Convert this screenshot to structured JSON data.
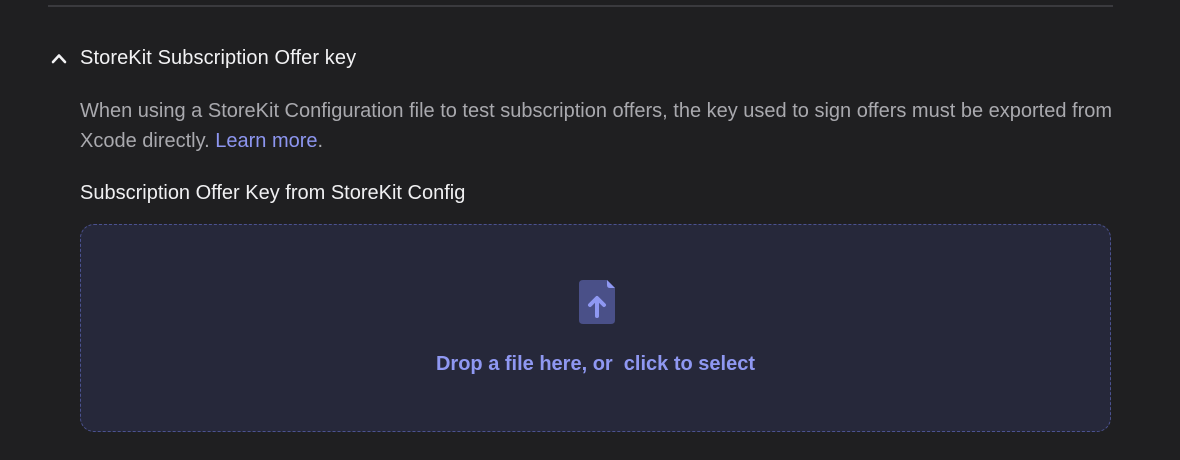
{
  "section": {
    "title": "StoreKit Subscription Offer key",
    "expanded_icon": "chevron-up-icon"
  },
  "description": {
    "text": "When using a StoreKit Configuration file to test subscription offers, the key used to sign offers must be exported from Xcode directly. ",
    "link": "Learn more",
    "suffix": "."
  },
  "field": {
    "label": "Subscription Offer Key from StoreKit Config"
  },
  "dropzone": {
    "icon": "file-upload-icon",
    "text": "Drop a file here, or  click to select"
  },
  "colors": {
    "accent": "#8f98f2",
    "background": "#1f1f21",
    "dropzone_bg": "#26283a"
  }
}
